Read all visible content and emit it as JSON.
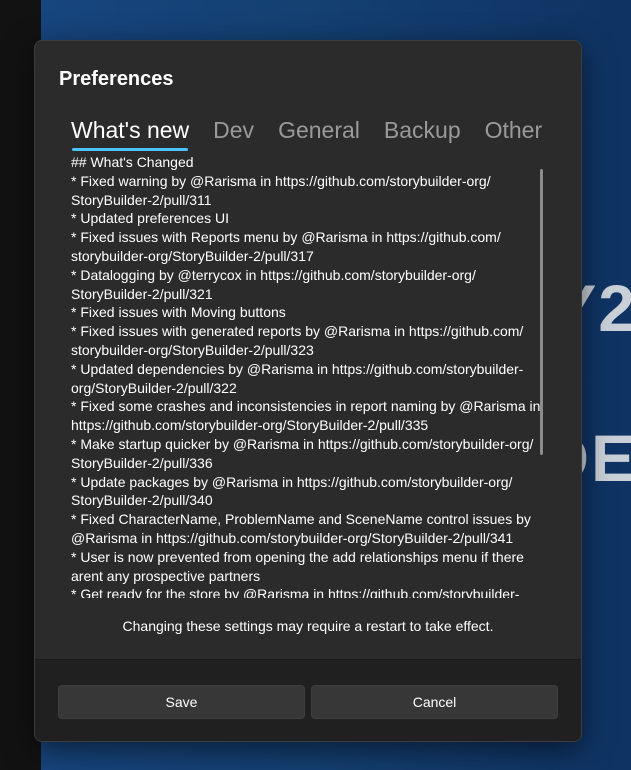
{
  "dialog": {
    "title": "Preferences",
    "tabs": [
      {
        "label": "What's new",
        "active": true
      },
      {
        "label": "Dev",
        "active": false
      },
      {
        "label": "General",
        "active": false
      },
      {
        "label": "Backup",
        "active": false
      },
      {
        "label": "Other",
        "active": false
      }
    ],
    "changelog_lines": [
      "## What's Changed",
      "* Fixed warning by @Rarisma in https://github.com/storybuilder-org/",
      "StoryBuilder-2/pull/311",
      "* Updated preferences UI",
      "* Fixed issues with Reports menu by @Rarisma in https://github.com/",
      "storybuilder-org/StoryBuilder-2/pull/317",
      "* Datalogging by @terrycox in https://github.com/storybuilder-org/",
      "StoryBuilder-2/pull/321",
      "* Fixed issues with Moving buttons",
      "* Fixed issues with generated reports by @Rarisma in https://github.com/",
      "storybuilder-org/StoryBuilder-2/pull/323",
      "* Updated dependencies by @Rarisma in https://github.com/storybuilder-",
      "org/StoryBuilder-2/pull/322",
      "* Fixed some crashes and inconsistencies in report naming by @Rarisma in",
      "https://github.com/storybuilder-org/StoryBuilder-2/pull/335",
      "* Make startup quicker by @Rarisma in https://github.com/storybuilder-org/",
      "StoryBuilder-2/pull/336",
      "* Update packages by @Rarisma in https://github.com/storybuilder-org/",
      "StoryBuilder-2/pull/340",
      "* Fixed CharacterName, ProblemName and SceneName control issues by",
      "@Rarisma in https://github.com/storybuilder-org/StoryBuilder-2/pull/341",
      "* User is now prevented from opening the add relationships menu if there",
      "arent any prospective partners",
      "* Get ready for the store by @Rarisma in https://github.com/storybuilder-"
    ],
    "notice": "Changing these settings may require a restart to take effect.",
    "save_label": "Save",
    "cancel_label": "Cancel"
  },
  "colors": {
    "accent": "#4cc2ff",
    "dialog_bg": "#2b2b2b",
    "footer_bg": "#202020"
  }
}
